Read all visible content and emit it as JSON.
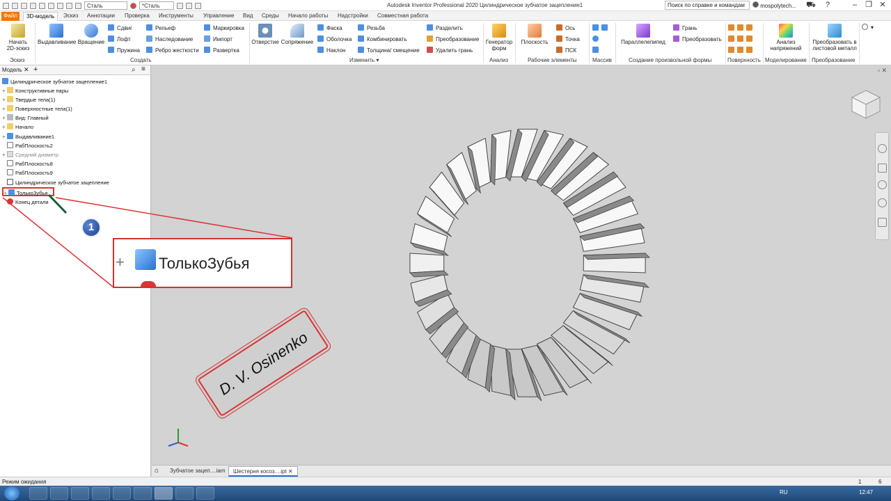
{
  "titlebar": {
    "material_value": "Сталь",
    "appearance_value": "*Сталь",
    "app_title": "Autodesk Inventor Professional 2020   Цилиндрическое зубчатое зацепление1",
    "help_search": "Поиск по справке и командам",
    "user": "mospolytech..."
  },
  "tabs": {
    "file": "Файл",
    "items": [
      "3D-модель",
      "Эскиз",
      "Аннотации",
      "Проверка",
      "Инструменты",
      "Управление",
      "Вид",
      "Среды",
      "Начало работы",
      "Надстройки",
      "Совместная работа"
    ]
  },
  "ribbon": {
    "start_sketch": "Начать 2D-эскиз",
    "extrude": "Выдавливание",
    "revolve": "Вращение",
    "sweep": "Сдвиг",
    "loft": "Лофт",
    "coil": "Пружина",
    "emboss": "Рельеф",
    "derive": "Наследование",
    "rib": "Ребро жесткости",
    "decal": "Маркировка",
    "import": "Импорт",
    "unwrap": "Развертка",
    "hole": "Отверстие",
    "fillet": "Сопряжение",
    "chamfer": "Фаска",
    "shell": "Оболочка",
    "draft": "Наклон",
    "thread": "Резьба",
    "combine": "Комбинировать",
    "thicken": "Толщина/ смещение",
    "split": "Разделить",
    "direct": "Преобразование",
    "delete_face": "Удалить грань",
    "shape_gen": "Генератор форм",
    "plane": "Плоскость",
    "axis": "Ось",
    "point": "Точка",
    "ucs": "ПСК",
    "box": "Параллелепипед",
    "face": "Грань",
    "convert": "Преобразовать",
    "stress": "Анализ напряжений",
    "to_sheet": "Преобразовать в листовой металл",
    "groups": {
      "sketch": "Эскиз",
      "create": "Создать",
      "modify": "Изменить",
      "analysis": "Анализ",
      "work": "Рабочие элементы",
      "pattern": "Массив",
      "freeform": "Создание произвольной формы",
      "surface": "Поверхность",
      "simulation": "Моделирование",
      "convert": "Преобразование"
    }
  },
  "browser": {
    "tab": "Модель",
    "tree": [
      {
        "label": "Цилиндрическое зубчатое зацепление1",
        "expander": ""
      },
      {
        "label": "Конструктивные пары",
        "expander": "+"
      },
      {
        "label": "Твердые тела(1)",
        "expander": "+"
      },
      {
        "label": "Поверхностные тела(1)",
        "expander": "+"
      },
      {
        "label": "Вид: Главный",
        "expander": "+"
      },
      {
        "label": "Начало",
        "expander": "+"
      },
      {
        "label": "Выдавливание1",
        "expander": "+"
      },
      {
        "label": "РабПлоскость2",
        "expander": ""
      },
      {
        "label": "Средний диаметр",
        "expander": "+"
      },
      {
        "label": "РабПлоскость8",
        "expander": ""
      },
      {
        "label": "РабПлоскость9",
        "expander": ""
      },
      {
        "label": "Цилиндрическое зубчатое зацепление",
        "expander": ""
      },
      {
        "label": "ТолькоЗубья",
        "expander": "+"
      },
      {
        "label": "Конец детали",
        "expander": ""
      }
    ]
  },
  "callout": {
    "badge": "1",
    "label": "ТолькоЗубья"
  },
  "watermark": "D. V. Osinenko",
  "doctabs": [
    "Зубчатое зацеп....iam",
    "Шестерня косоз....ipt"
  ],
  "status": {
    "text": "Режим ожидания",
    "num1": "1",
    "num2": "6"
  },
  "taskbar": {
    "lang": "RU",
    "time": "12:47"
  },
  "gear": {
    "teeth": 28
  }
}
